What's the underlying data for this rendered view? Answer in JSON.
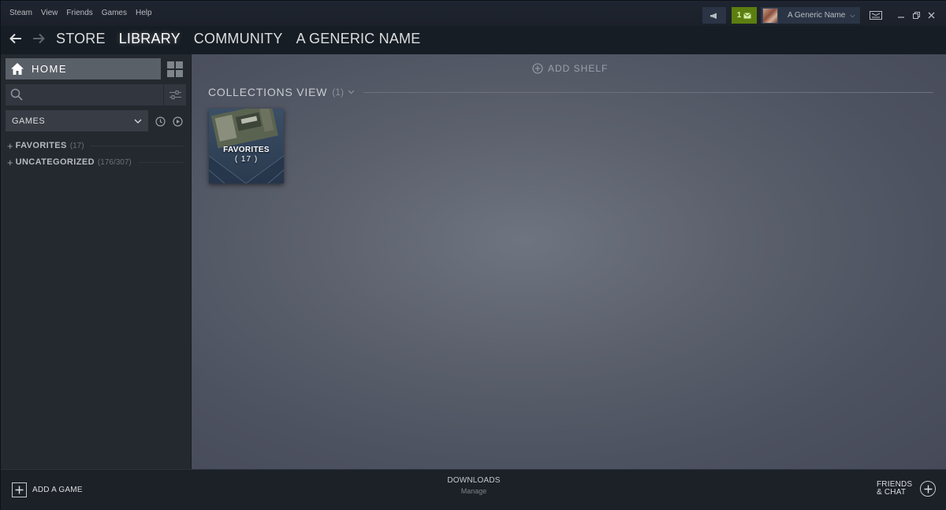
{
  "menu": {
    "items": [
      "Steam",
      "View",
      "Friends",
      "Games",
      "Help"
    ]
  },
  "notifications": {
    "count": "1"
  },
  "account": {
    "name": "A Generic Name"
  },
  "nav": {
    "links": [
      {
        "label": "STORE"
      },
      {
        "label": "LIBRARY",
        "active": true
      },
      {
        "label": "COMMUNITY"
      },
      {
        "label": "A GENERIC NAME"
      }
    ]
  },
  "sidebar": {
    "home_label": "HOME",
    "search_placeholder": "",
    "filter_label": "GAMES",
    "collections": [
      {
        "name": "FAVORITES",
        "count": "(17)"
      },
      {
        "name": "UNCATEGORIZED",
        "count": "(176/307)"
      }
    ]
  },
  "main": {
    "add_shelf_label": "ADD SHELF",
    "shelf_title": "COLLECTIONS VIEW",
    "shelf_count": "(1)",
    "tiles": [
      {
        "name": "FAVORITES",
        "count": "( 17 )"
      }
    ]
  },
  "bottom": {
    "add_game_label": "ADD A GAME",
    "downloads_label": "DOWNLOADS",
    "downloads_sub": "Manage",
    "friends_line1": "FRIENDS",
    "friends_line2": "& CHAT"
  },
  "icons": {
    "announce": "megaphone-icon",
    "mail": "envelope-icon",
    "big_picture": "big-picture-icon",
    "home": "home-icon",
    "grid": "grid-icon",
    "search": "search-icon",
    "filter": "sliders-icon",
    "recent": "clock-icon",
    "play": "play-icon"
  },
  "colors": {
    "accent_green": "#5c7e10",
    "window_bg": "#171d25",
    "sidebar_bg": "#24282f"
  }
}
